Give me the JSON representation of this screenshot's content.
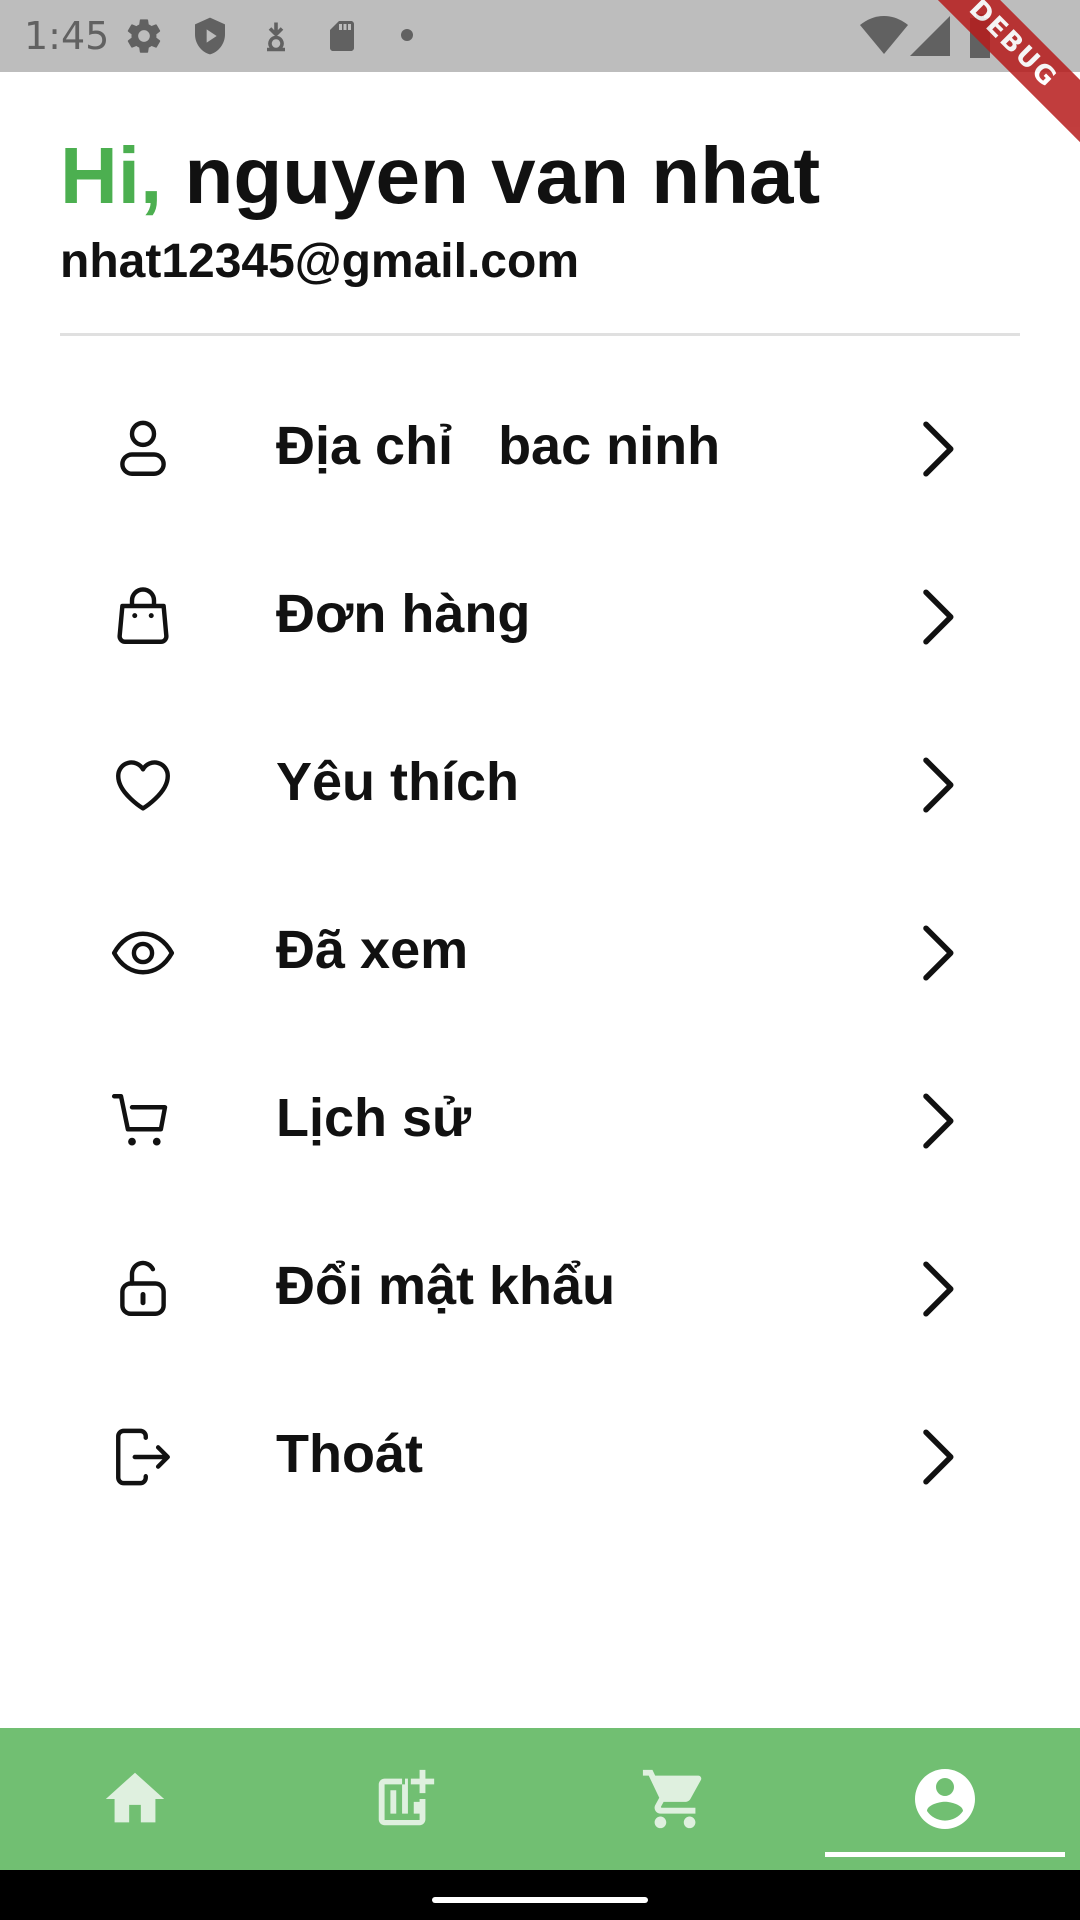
{
  "status_bar": {
    "time": "1:45",
    "icons": [
      "gear-icon",
      "shield-icon",
      "download-icon",
      "sd-card-icon",
      "dot-icon",
      "wifi-icon",
      "signal-icon",
      "battery-icon"
    ],
    "debug_banner": "DEBUG"
  },
  "header": {
    "greeting_prefix": "Hi,",
    "user_name": " nguyen van nhat",
    "email": "nhat12345@gmail.com",
    "accent_color": "#4caf50"
  },
  "menu": {
    "items": [
      {
        "label": "Địa chỉ   bac ninh",
        "icon": "user-icon"
      },
      {
        "label": "Đơn hàng",
        "icon": "bag-icon"
      },
      {
        "label": "Yêu thích",
        "icon": "heart-icon"
      },
      {
        "label": "Đã xem",
        "icon": "eye-icon"
      },
      {
        "label": "Lịch sử",
        "icon": "cart-icon"
      },
      {
        "label": "Đổi mật khẩu",
        "icon": "unlock-icon"
      },
      {
        "label": "Thoát",
        "icon": "logout-icon"
      }
    ]
  },
  "bottom_nav": {
    "items": [
      "home-icon",
      "stats-icon",
      "shopping-cart-icon",
      "account-icon"
    ],
    "active_index": 3,
    "background_color": "#71bf72"
  }
}
